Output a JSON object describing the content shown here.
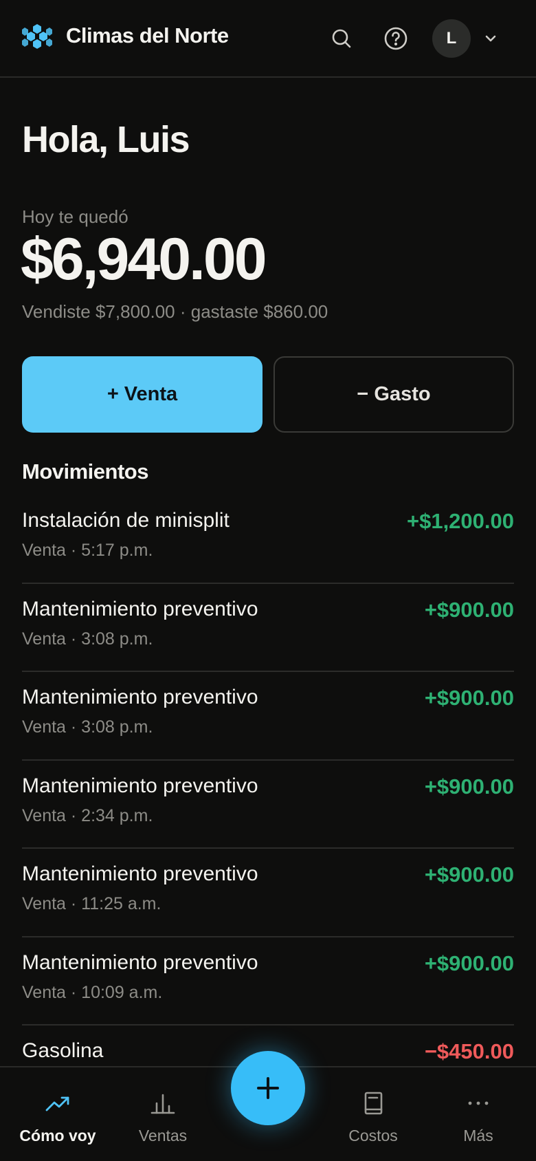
{
  "header": {
    "brand": "Climas del Norte",
    "avatar_initial": "L"
  },
  "main": {
    "greeting": "Hola, Luis",
    "today_label": "Hoy te quedó",
    "balance": "$6,940.00",
    "summary": "Vendiste $7,800.00 · gastaste $860.00",
    "venta_button": "+ Venta",
    "gasto_button": "− Gasto",
    "movements_title": "Movimientos"
  },
  "movements": [
    {
      "title": "Instalación de minisplit",
      "subtitle": "Venta · 5:17 p.m.",
      "amount": "+$1,200.00",
      "type": "income"
    },
    {
      "title": "Mantenimiento preventivo",
      "subtitle": "Venta · 3:08 p.m.",
      "amount": "+$900.00",
      "type": "income"
    },
    {
      "title": "Mantenimiento preventivo",
      "subtitle": "Venta · 3:08 p.m.",
      "amount": "+$900.00",
      "type": "income"
    },
    {
      "title": "Mantenimiento preventivo",
      "subtitle": "Venta · 2:34 p.m.",
      "amount": "+$900.00",
      "type": "income"
    },
    {
      "title": "Mantenimiento preventivo",
      "subtitle": "Venta · 11:25 a.m.",
      "amount": "+$900.00",
      "type": "income"
    },
    {
      "title": "Mantenimiento preventivo",
      "subtitle": "Venta · 10:09 a.m.",
      "amount": "+$900.00",
      "type": "income"
    },
    {
      "title": "Gasolina",
      "subtitle": "",
      "amount": "−$450.00",
      "type": "expense"
    }
  ],
  "nav": {
    "items": [
      {
        "label": "Cómo voy",
        "icon": "trending-up-icon"
      },
      {
        "label": "Ventas",
        "icon": "bar-chart-icon"
      },
      {
        "label": "Costos",
        "icon": "book-icon"
      },
      {
        "label": "Más",
        "icon": "more-icon"
      }
    ],
    "fab_icon": "plus-icon"
  },
  "colors": {
    "accent": "#5ccaf7",
    "fab": "#37bdf8",
    "income": "#2eb173",
    "expense": "#ef5a5a",
    "background": "#0e0e0d"
  }
}
